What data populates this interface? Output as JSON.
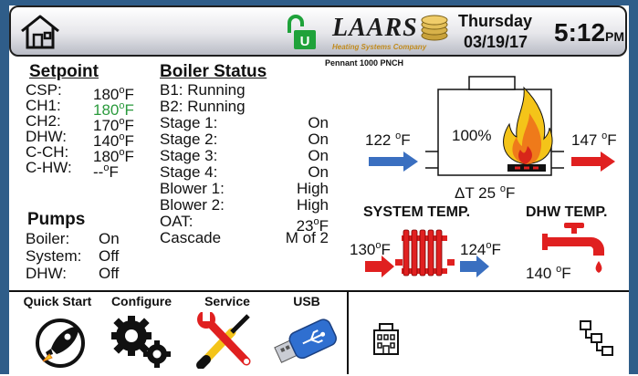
{
  "header": {
    "brand": "LAARS",
    "brand_tagline": "Heating Systems Company",
    "model": "Pennant 1000 PNCH",
    "day": "Thursday",
    "date": "03/19/17",
    "time": "5:12",
    "ampm": "PM",
    "home_icon": "home-icon",
    "lock_icon": "unlock-icon"
  },
  "setpoint": {
    "title": "Setpoint",
    "rows": [
      {
        "label": "CSP:",
        "value": "180",
        "unit": "F",
        "color": "#111111"
      },
      {
        "label": "CH1:",
        "value": "180",
        "unit": "F",
        "color": "#2a9a3c"
      },
      {
        "label": "CH2:",
        "value": "170",
        "unit": "F",
        "color": "#111111"
      },
      {
        "label": "DHW:",
        "value": "140",
        "unit": "F",
        "color": "#111111"
      },
      {
        "label": "C-CH:",
        "value": "180",
        "unit": "F",
        "color": "#111111"
      },
      {
        "label": "C-HW:",
        "value": "--",
        "unit": "F",
        "color": "#111111"
      }
    ]
  },
  "pumps": {
    "title": "Pumps",
    "rows": [
      {
        "label": "Boiler:",
        "value": "On"
      },
      {
        "label": "System:",
        "value": "Off"
      },
      {
        "label": "DHW:",
        "value": "Off"
      }
    ]
  },
  "boiler_status": {
    "title": "Boiler Status",
    "lines": [
      "B1: Running",
      "B2: Running"
    ],
    "rows": [
      {
        "label": "Stage 1:",
        "value": "On"
      },
      {
        "label": "Stage 2:",
        "value": "On"
      },
      {
        "label": "Stage 3:",
        "value": "On"
      },
      {
        "label": "Stage 4:",
        "value": "On"
      },
      {
        "label": "Blower 1:",
        "value": "High"
      },
      {
        "label": "Blower 2:",
        "value": "High"
      },
      {
        "label": "OAT:",
        "value": "23",
        "unit": "F"
      },
      {
        "label": "Cascade",
        "value": "M of 2"
      }
    ]
  },
  "diagram": {
    "inlet_temp": "122",
    "outlet_temp": "147",
    "firing_rate": "100%",
    "delta_t_label": "ΔT 25",
    "system_title": "SYSTEM TEMP.",
    "system_in": "130",
    "system_out": "124",
    "dhw_title": "DHW TEMP.",
    "dhw_temp": "140",
    "deg": "o",
    "unit_f": "F"
  },
  "nav": {
    "items": [
      {
        "label": "Quick Start",
        "icon": "rocket-icon"
      },
      {
        "label": "Configure",
        "icon": "gears-icon"
      },
      {
        "label": "Service",
        "icon": "tools-icon"
      },
      {
        "label": "USB",
        "icon": "usb-drive-icon"
      }
    ],
    "right_icons": [
      "building-icon",
      "network-icon"
    ]
  },
  "colors": {
    "frame": "#2f5d89",
    "cold_arrow": "#3a6fc0",
    "hot_arrow": "#e02020",
    "setpoint_green": "#2a9a3c",
    "radiator": "#e02020"
  }
}
